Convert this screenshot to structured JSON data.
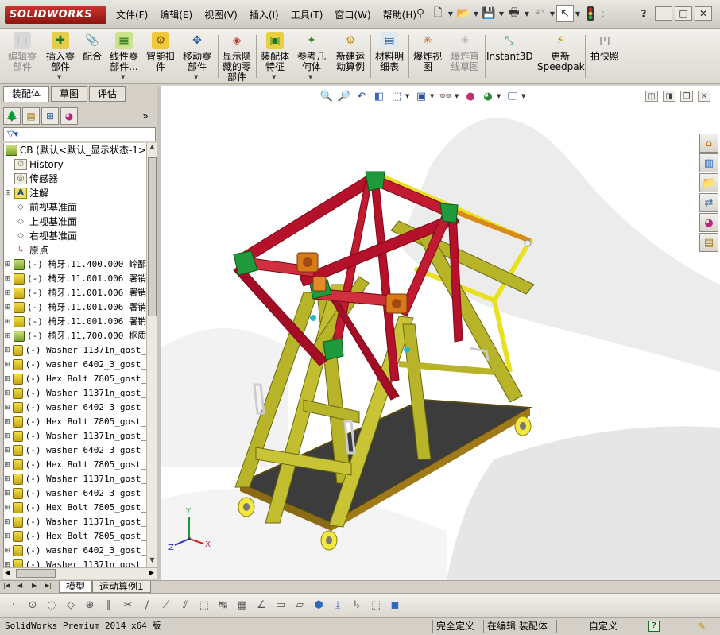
{
  "app": {
    "logo_text": "SOLIDWORKS"
  },
  "menus": [
    "文件(F)",
    "编辑(E)",
    "视图(V)",
    "插入(I)",
    "工具(T)",
    "窗口(W)",
    "帮助(H)"
  ],
  "window_controls": [
    "?",
    "–",
    "□",
    "✕"
  ],
  "commands": [
    {
      "label": "编辑零\n部件",
      "enabled": false
    },
    {
      "label": "插入零\n部件",
      "enabled": true
    },
    {
      "label": "配合",
      "enabled": true
    },
    {
      "label": "线性零\n部件...",
      "enabled": true
    },
    {
      "label": "智能扣\n件",
      "enabled": true
    },
    {
      "label": "移动零\n部件",
      "enabled": true
    },
    {
      "label": "显示隐\n藏的零\n部件",
      "enabled": true
    },
    {
      "label": "装配体\n特征",
      "enabled": true
    },
    {
      "label": "参考几\n何体",
      "enabled": true
    },
    {
      "label": "新建运\n动算例",
      "enabled": true
    },
    {
      "label": "材料明\n细表",
      "enabled": true
    },
    {
      "label": "爆炸视\n图",
      "enabled": true
    },
    {
      "label": "爆炸直\n线草图",
      "enabled": false
    },
    {
      "label": "Instant3D",
      "enabled": true
    },
    {
      "label": "更新\nSpeedpak",
      "enabled": true
    },
    {
      "label": "拍快照",
      "enabled": true
    }
  ],
  "fm_tabs": [
    "装配体",
    "草图",
    "评估"
  ],
  "tree": {
    "root": "CB  (默认<默认_显示状态-1>",
    "items": [
      {
        "label": "History",
        "icon": "history-icon",
        "kind": "node",
        "exp": false
      },
      {
        "label": "传感器",
        "icon": "sensor-icon",
        "kind": "node",
        "exp": false
      },
      {
        "label": "注解",
        "icon": "annotation-icon",
        "kind": "node",
        "exp": true
      },
      {
        "label": "前视基准面",
        "icon": "plane-icon",
        "kind": "node",
        "exp": false
      },
      {
        "label": "上视基准面",
        "icon": "plane-icon",
        "kind": "node",
        "exp": false
      },
      {
        "label": "右视基准面",
        "icon": "plane-icon",
        "kind": "node",
        "exp": false
      },
      {
        "label": "原点",
        "icon": "origin-icon",
        "kind": "node",
        "exp": false
      },
      {
        "label": "(-) 椅牙.11.400.000 岭鄙",
        "icon": "subassembly-icon",
        "kind": "asm",
        "exp": true
      },
      {
        "label": "(-) 椅牙.11.001.006 署销",
        "icon": "part-icon",
        "kind": "part",
        "exp": true
      },
      {
        "label": "(-) 椅牙.11.001.006 署销",
        "icon": "part-icon",
        "kind": "part",
        "exp": true
      },
      {
        "label": "(-) 椅牙.11.001.006 署销",
        "icon": "part-icon",
        "kind": "part",
        "exp": true
      },
      {
        "label": "(-) 椅牙.11.001.006 署销",
        "icon": "part-icon",
        "kind": "part",
        "exp": true
      },
      {
        "label": "(-) 椅牙.11.700.000 枢质",
        "icon": "subassembly-icon",
        "kind": "asm",
        "exp": true
      },
      {
        "label": "(-) Washer 11371n_gost_",
        "icon": "part-icon",
        "kind": "part",
        "exp": true
      },
      {
        "label": "(-) washer 6402_3_gost_",
        "icon": "part-icon",
        "kind": "part",
        "exp": true
      },
      {
        "label": "(-) Hex Bolt 7805_gost_",
        "icon": "part-icon",
        "kind": "part",
        "exp": true
      },
      {
        "label": "(-) Washer 11371n_gost_",
        "icon": "part-icon",
        "kind": "part",
        "exp": true
      },
      {
        "label": "(-) washer 6402_3_gost_",
        "icon": "part-icon",
        "kind": "part",
        "exp": true
      },
      {
        "label": "(-) Hex Bolt 7805_gost_",
        "icon": "part-icon",
        "kind": "part",
        "exp": true
      },
      {
        "label": "(-) Washer 11371n_gost_",
        "icon": "part-icon",
        "kind": "part",
        "exp": true
      },
      {
        "label": "(-) washer 6402_3_gost_",
        "icon": "part-icon",
        "kind": "part",
        "exp": true
      },
      {
        "label": "(-) Hex Bolt 7805_gost_",
        "icon": "part-icon",
        "kind": "part",
        "exp": true
      },
      {
        "label": "(-) Washer 11371n_gost_",
        "icon": "part-icon",
        "kind": "part",
        "exp": true
      },
      {
        "label": "(-) washer 6402_3_gost_",
        "icon": "part-icon",
        "kind": "part",
        "exp": true
      },
      {
        "label": "(-) Hex Bolt 7805_gost_",
        "icon": "part-icon",
        "kind": "part",
        "exp": true
      },
      {
        "label": "(-) Washer 11371n_gost_",
        "icon": "part-icon",
        "kind": "part",
        "exp": true
      },
      {
        "label": "(-) Hex Bolt 7805_gost_",
        "icon": "part-icon",
        "kind": "part",
        "exp": true
      },
      {
        "label": "(-) washer 6402_3_gost_",
        "icon": "part-icon",
        "kind": "part",
        "exp": true
      },
      {
        "label": "(-) Washer 11371n_gost_",
        "icon": "part-icon",
        "kind": "part",
        "exp": true
      }
    ]
  },
  "triad": {
    "x": "X",
    "y": "Y",
    "z": "Z"
  },
  "bottom_tabs": [
    "模型",
    "运动算例1"
  ],
  "status": {
    "app_version": "SolidWorks Premium 2014 x64 版",
    "defined": "完全定义",
    "editing": "在编辑 装配体",
    "units": "自定义",
    "help": "?"
  },
  "colors": {
    "frame_red": "#b5112a",
    "frame_yellow": "#b8b82a",
    "base_plate": "#3a3a3a",
    "joint_green": "#1e9a3c",
    "accent_orange": "#d87a1a"
  }
}
